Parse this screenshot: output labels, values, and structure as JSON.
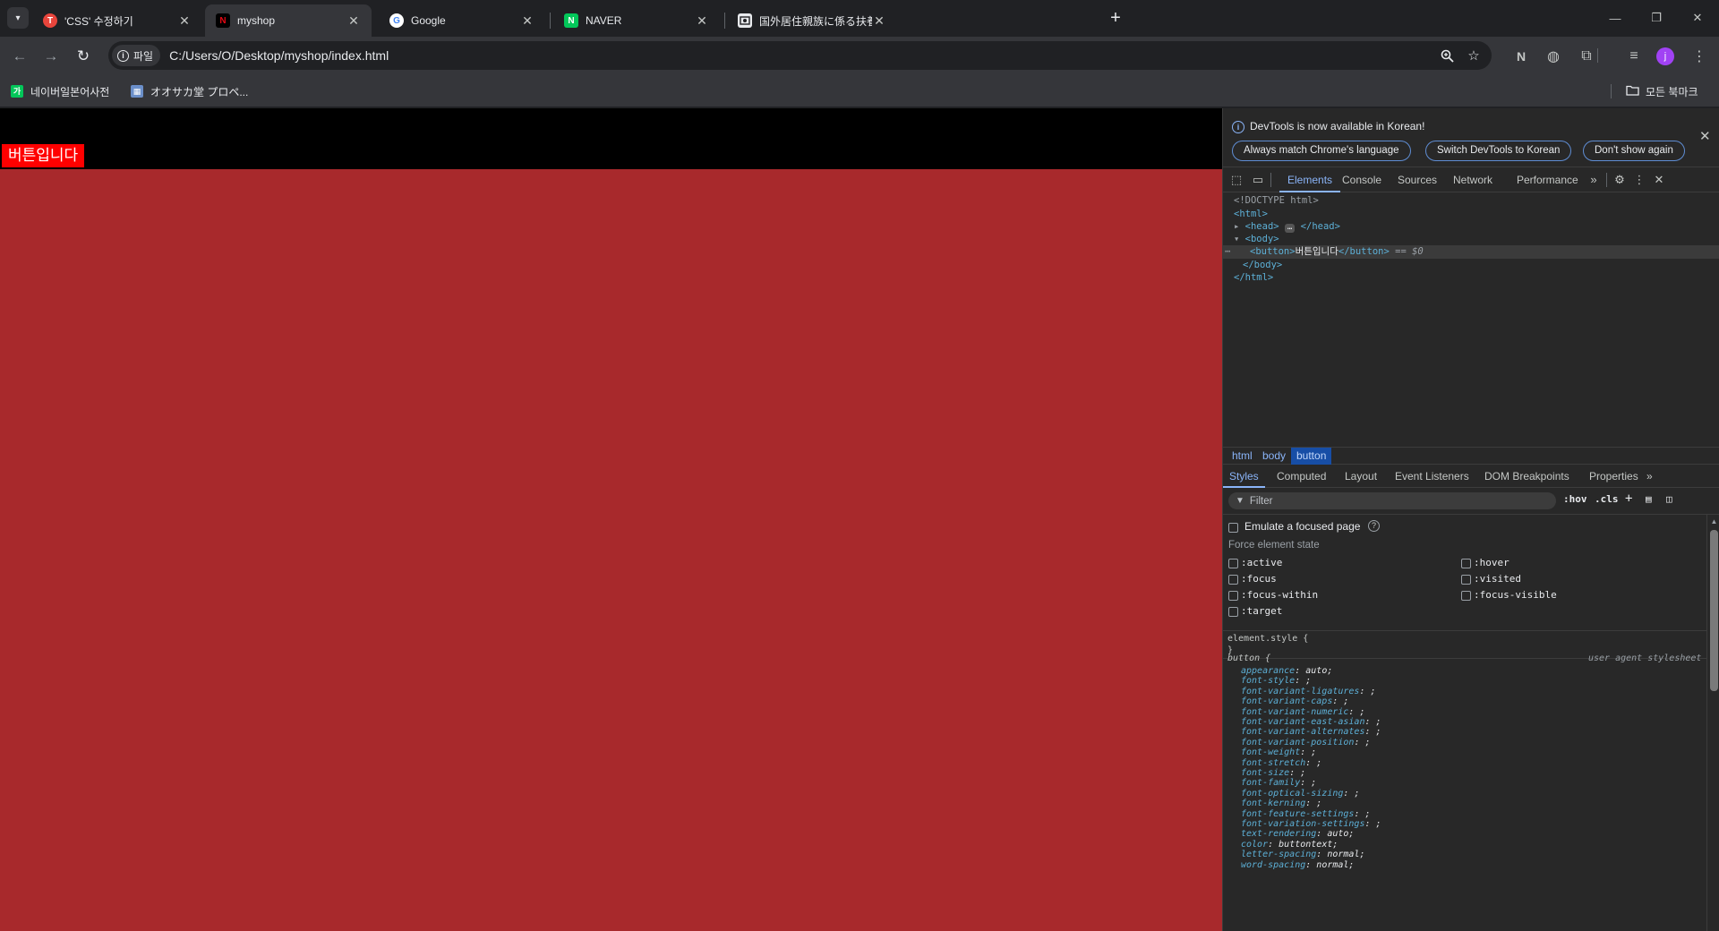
{
  "tabs": [
    {
      "title": "'CSS' 수정하기",
      "favicon": "T",
      "favicon_color": "#e8453c"
    },
    {
      "title": "myshop",
      "favicon": "N",
      "favicon_color": "#000000"
    },
    {
      "title": "Google",
      "favicon": "G",
      "favicon_color": "#ffffff"
    },
    {
      "title": "NAVER",
      "favicon": "N",
      "favicon_color": "#03c75a"
    },
    {
      "title": "国外居住親族に係る扶養控除等",
      "favicon": "doc",
      "favicon_color": "#e8eaed"
    }
  ],
  "toolbar": {
    "chip_label": "파일",
    "url": "C:/Users/O/Desktop/myshop/index.html",
    "avatar_letter": "j"
  },
  "bookmarks": {
    "items": [
      {
        "label": "네이버일본어사전",
        "icon_text": "가"
      },
      {
        "label": "オオサカ堂 プロペ...",
        "icon_text": "▦"
      }
    ],
    "all_bookmarks": "모든 북마크"
  },
  "page": {
    "button_text": "버튼입니다",
    "background": "#a8292c",
    "button_color": "#ff0000"
  },
  "devtools": {
    "banner": {
      "message": "DevTools is now available in Korean!",
      "btn_match": "Always match Chrome's language",
      "btn_switch": "Switch DevTools to Korean",
      "btn_dont": "Don't show again"
    },
    "tabs": [
      "Elements",
      "Console",
      "Sources",
      "Network",
      "Performance"
    ],
    "dom": {
      "doctype": "<!DOCTYPE html>",
      "html_open": "<html>",
      "head_open": "<head>",
      "head_close": "</head>",
      "body_open": "<body>",
      "button_open": "<button>",
      "button_text": "버튼입니다",
      "button_close": "</button>",
      "dollar0": "== $0",
      "body_close": "</body>",
      "html_close": "</html>"
    },
    "breadcrumbs": [
      "html",
      "body",
      "button"
    ],
    "sub_tabs": [
      "Styles",
      "Computed",
      "Layout",
      "Event Listeners",
      "DOM Breakpoints",
      "Properties"
    ],
    "filter_placeholder": "Filter",
    "hov": ":hov",
    "cls": ".cls",
    "emulate_focus": "Emulate a focused page",
    "force_state_title": "Force element state",
    "states_left": [
      ":active",
      ":focus",
      ":focus-within",
      ":target"
    ],
    "states_right": [
      ":hover",
      ":visited",
      ":focus-visible"
    ],
    "element_style_open": "element.style {",
    "element_style_close": "}",
    "rule_selector": "button {",
    "user_agent": "user agent stylesheet",
    "properties": [
      {
        "name": "appearance",
        "value": "auto;"
      },
      {
        "name": "font-style",
        "value": ";"
      },
      {
        "name": "font-variant-ligatures",
        "value": ";"
      },
      {
        "name": "font-variant-caps",
        "value": ";"
      },
      {
        "name": "font-variant-numeric",
        "value": ";"
      },
      {
        "name": "font-variant-east-asian",
        "value": ";"
      },
      {
        "name": "font-variant-alternates",
        "value": ";"
      },
      {
        "name": "font-variant-position",
        "value": ";"
      },
      {
        "name": "font-weight",
        "value": ";"
      },
      {
        "name": "font-stretch",
        "value": ";"
      },
      {
        "name": "font-size",
        "value": ";"
      },
      {
        "name": "font-family",
        "value": ";"
      },
      {
        "name": "font-optical-sizing",
        "value": ";"
      },
      {
        "name": "font-kerning",
        "value": ";"
      },
      {
        "name": "font-feature-settings",
        "value": ";"
      },
      {
        "name": "font-variation-settings",
        "value": ";"
      },
      {
        "name": "text-rendering",
        "value": "auto;"
      },
      {
        "name": "color",
        "value": "buttontext;"
      },
      {
        "name": "letter-spacing",
        "value": "normal;"
      },
      {
        "name": "word-spacing",
        "value": "normal;"
      }
    ]
  }
}
